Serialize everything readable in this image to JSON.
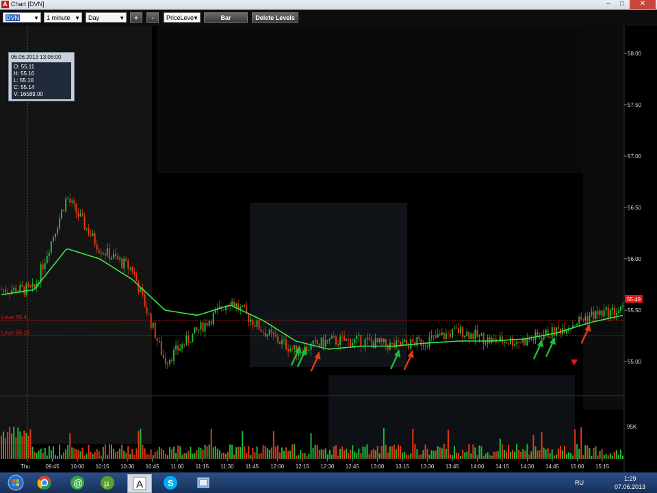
{
  "window": {
    "title": "Chart [DVN]",
    "app_letter": "A",
    "min": "–",
    "max": "□",
    "close": "✕"
  },
  "toolbar": {
    "symbol": "DVN",
    "interval": "1 minute",
    "range": "Day",
    "plus": "+",
    "minus": "-",
    "mode": "PriceLeve",
    "bar_label": "Bar",
    "delete_levels": "Delete Levels"
  },
  "ohlc": {
    "date": "06.06.2013 13:06:00",
    "open": "O: 55.11",
    "high": "H: 55.16",
    "low": "L: 55.10",
    "close": "C: 55.14",
    "volume": "V: 16589.00"
  },
  "levels": [
    {
      "label": "Level 55.4",
      "price": 55.4
    },
    {
      "label": "Level 55.25",
      "price": 55.25
    }
  ],
  "colors": {
    "up": "#1fb83c",
    "down": "#e03a12",
    "ma": "#38e84a",
    "level": "#d01818",
    "price_tag": "#e01818"
  },
  "chart_data": {
    "type": "line",
    "price_axis": [
      "58.00",
      "57.50",
      "57.00",
      "56.50",
      "56.00",
      "55.50",
      "55.00"
    ],
    "volume_axis": "95K",
    "last_price": "55.49",
    "x_ticks": [
      "Thu",
      "09:45",
      "10:00",
      "10:15",
      "10:30",
      "10:45",
      "11:00",
      "11:15",
      "11:30",
      "11:45",
      "12:00",
      "12:15",
      "12:30",
      "12:45",
      "13:00",
      "13:15",
      "13:30",
      "13:45",
      "14:00",
      "14:15",
      "14:30",
      "14:45",
      "15:00",
      "15:15"
    ],
    "ylim": [
      54.8,
      58.2
    ],
    "series": [
      {
        "values": [
          55.7,
          55.7,
          56.6,
          56.1,
          55.9,
          55.0,
          55.3,
          55.6,
          55.3,
          55.1,
          55.2,
          55.2,
          55.15,
          55.2,
          55.3,
          55.2,
          55.2,
          55.3,
          55.45,
          55.5
        ]
      }
    ],
    "ma_values": [
      55.65,
      55.7,
      56.1,
      56.0,
      55.8,
      55.5,
      55.45,
      55.55,
      55.4,
      55.2,
      55.12,
      55.15,
      55.15,
      55.18,
      55.2,
      55.2,
      55.22,
      55.28,
      55.38,
      55.45
    ],
    "annotations": {
      "green_arrows": 5,
      "red_arrows": 4
    }
  },
  "taskbar": {
    "apps": [
      "chrome-icon",
      "at-icon",
      "utorrent-icon",
      "a-app-icon",
      "skype-icon",
      "files-icon"
    ],
    "lang": "RU",
    "time": "1:29",
    "date": "07.06.2013"
  }
}
